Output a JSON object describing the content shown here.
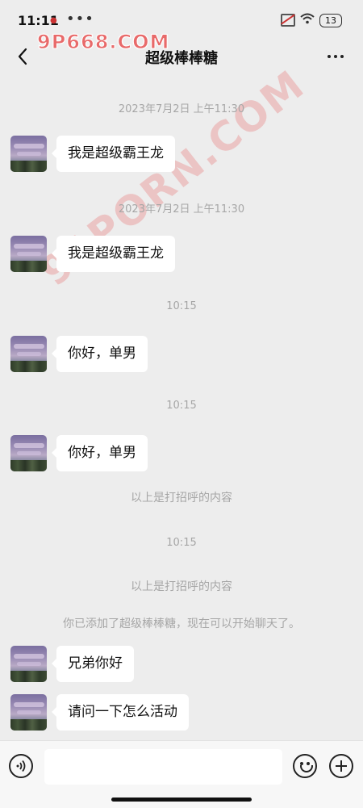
{
  "status_bar": {
    "time": "11:11",
    "battery": "13"
  },
  "watermarks": {
    "top": "9P668.COM",
    "diagonal": "91PORN.COM"
  },
  "nav": {
    "title": "超级棒棒糖"
  },
  "chat": {
    "timestamp_1": "2023年7月2日 上午11:30",
    "message_1": "我是超级霸王龙",
    "timestamp_2": "2023年7月2日 上午11:30",
    "message_2": "我是超级霸王龙",
    "timestamp_3": "10:15",
    "message_3": "你好，单男",
    "timestamp_4": "10:15",
    "message_4": "你好，单男",
    "system_1": "以上是打招呼的内容",
    "timestamp_5": "10:15",
    "system_2": "以上是打招呼的内容",
    "system_3": "你已添加了超级棒棒糖，现在可以开始聊天了。",
    "message_5": "兄弟你好",
    "message_6": "请问一下怎么活动"
  },
  "input": {
    "value": ""
  }
}
